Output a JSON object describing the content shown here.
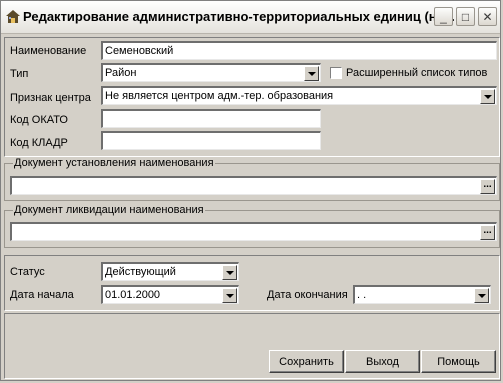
{
  "window": {
    "title": "Редактирование административно-территориальных единиц (на...",
    "icon": "house-icon",
    "controls": {
      "minimize": "_",
      "maximize": "□",
      "close": "✕"
    }
  },
  "form": {
    "name": {
      "label": "Наименование",
      "value": "Семеновский"
    },
    "type": {
      "label": "Тип",
      "value": "Район"
    },
    "extended_types": {
      "label": "Расширенный список типов",
      "checked": false
    },
    "center": {
      "label": "Признак центра",
      "value": "Не является центром адм.-тер. образования"
    },
    "okato": {
      "label": "Код ОКАТО",
      "value": ""
    },
    "kladr": {
      "label": "Код КЛАДР",
      "value": ""
    }
  },
  "doc_establish": {
    "title": "Документ установления наименования",
    "value": "",
    "button": "..."
  },
  "doc_liquidate": {
    "title": "Документ ликвидации наименования",
    "value": "",
    "button": "..."
  },
  "status": {
    "status": {
      "label": "Статус",
      "value": "Действующий"
    },
    "start_date": {
      "label": "Дата начала",
      "value": "01.01.2000"
    },
    "end_date": {
      "label": "Дата окончания",
      "value": " .  ."
    }
  },
  "buttons": {
    "save": "Сохранить",
    "exit": "Выход",
    "help": "Помощь"
  }
}
